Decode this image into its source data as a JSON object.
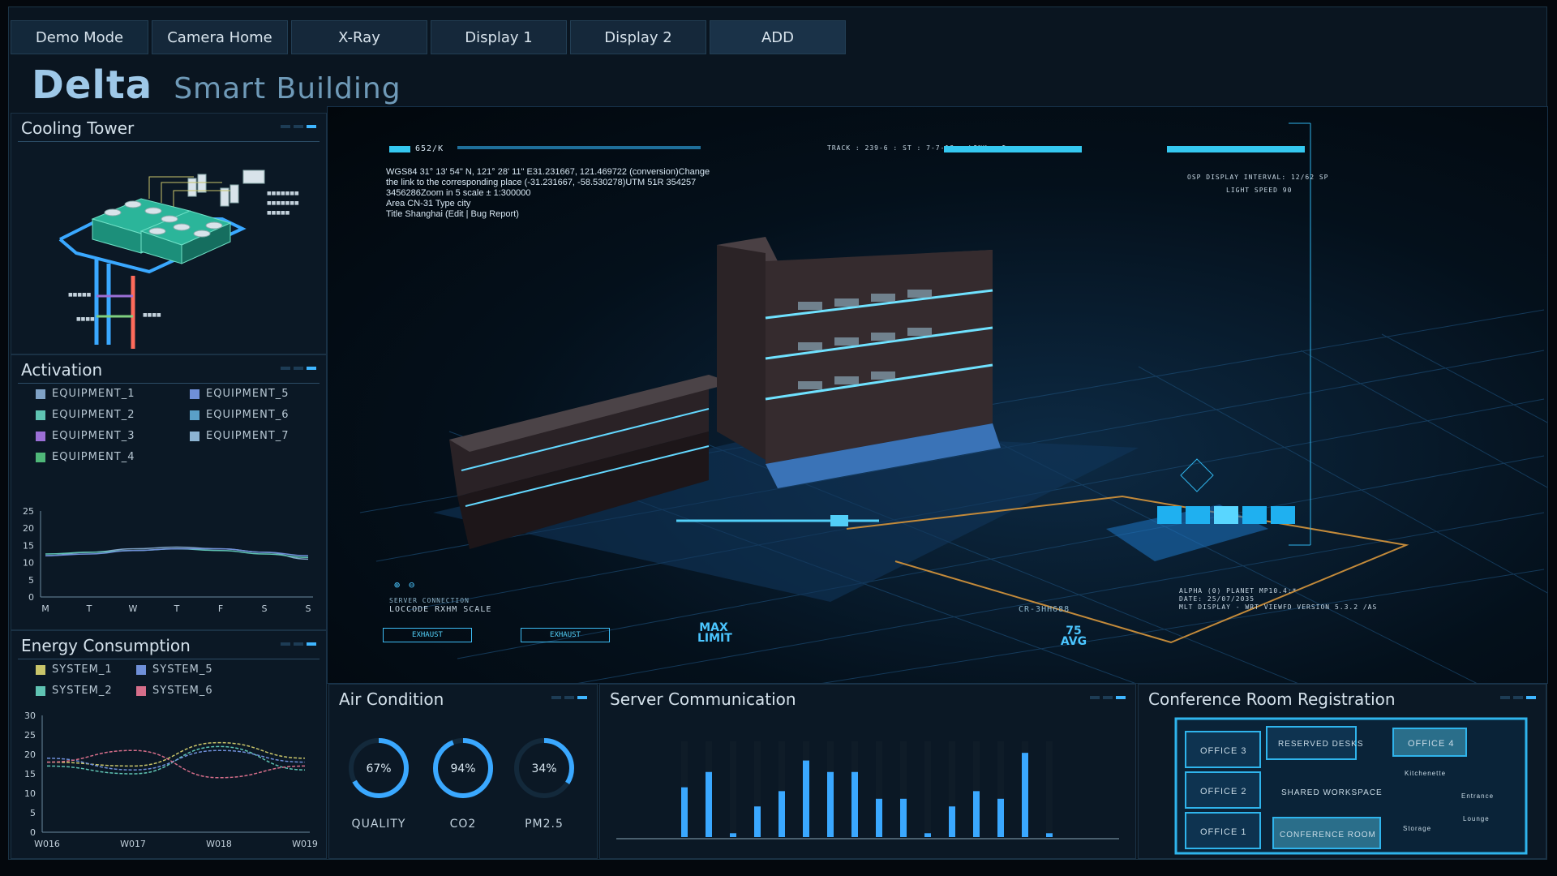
{
  "tabs": [
    {
      "label": "Demo Mode"
    },
    {
      "label": "Camera Home"
    },
    {
      "label": "X-Ray"
    },
    {
      "label": "Display 1"
    },
    {
      "label": "Display 2"
    },
    {
      "label": "ADD"
    }
  ],
  "header": {
    "brand": "Delta",
    "subtitle": "Smart Building"
  },
  "cooling_tower": {
    "title": "Cooling Tower"
  },
  "activation": {
    "title": "Activation",
    "legend": [
      {
        "label": "EQUIPMENT_1",
        "color": "#7fa2c6"
      },
      {
        "label": "EQUIPMENT_2",
        "color": "#5fc3b3"
      },
      {
        "label": "EQUIPMENT_3",
        "color": "#9b6fd6"
      },
      {
        "label": "EQUIPMENT_4",
        "color": "#4fb779"
      },
      {
        "label": "EQUIPMENT_5",
        "color": "#6f8fd8"
      },
      {
        "label": "EQUIPMENT_6",
        "color": "#5aa0c8"
      },
      {
        "label": "EQUIPMENT_7",
        "color": "#8db4d2"
      }
    ]
  },
  "energy": {
    "title": "Energy Consumption",
    "legend": [
      {
        "label": "SYSTEM_1",
        "color": "#c9c56a"
      },
      {
        "label": "SYSTEM_5",
        "color": "#6f8fd8"
      },
      {
        "label": "SYSTEM_2",
        "color": "#5fc3b3"
      },
      {
        "label": "SYSTEM_6",
        "color": "#d66e8a"
      }
    ]
  },
  "chart_data": [
    {
      "type": "line",
      "categories": [
        "M",
        "T",
        "W",
        "T",
        "F",
        "S",
        "S"
      ],
      "yticks": [
        0,
        5,
        10,
        15,
        20,
        25
      ],
      "ylim": [
        0,
        25
      ],
      "series": [
        {
          "name": "EQUIPMENT_1",
          "values": [
            12,
            13,
            14,
            14.5,
            14,
            13,
            11
          ]
        },
        {
          "name": "EQUIPMENT_2",
          "values": [
            12.5,
            13,
            13.5,
            14,
            13.5,
            12.5,
            11.5
          ]
        },
        {
          "name": "EQUIPMENT_5",
          "values": [
            12,
            12.5,
            13.5,
            14,
            14,
            13,
            12
          ]
        }
      ]
    },
    {
      "type": "line",
      "categories": [
        "W016",
        "W017",
        "W018",
        "W019"
      ],
      "yticks": [
        0,
        5,
        10,
        15,
        20,
        25,
        30
      ],
      "ylim": [
        0,
        30
      ],
      "series": [
        {
          "name": "SYSTEM_1",
          "values": [
            18,
            17,
            23,
            19
          ]
        },
        {
          "name": "SYSTEM_2",
          "values": [
            17,
            15,
            22,
            16
          ]
        },
        {
          "name": "SYSTEM_5",
          "values": [
            19,
            16,
            21,
            18
          ]
        },
        {
          "name": "SYSTEM_6",
          "values": [
            18,
            21,
            14,
            17
          ]
        }
      ]
    },
    {
      "type": "bar",
      "values": [
        13,
        17,
        1,
        8,
        12,
        20,
        17,
        17,
        10,
        10,
        1,
        8,
        12,
        10,
        22,
        1
      ]
    }
  ],
  "air_condition": {
    "title": "Air Condition",
    "gauges": [
      {
        "label": "QUALITY",
        "value": 67,
        "text": "67%"
      },
      {
        "label": "CO2",
        "value": 94,
        "text": "94%"
      },
      {
        "label": "PM2.5",
        "value": 34,
        "text": "34%"
      }
    ]
  },
  "server": {
    "title": "Server Communication"
  },
  "conference": {
    "title": "Conference Room Registration",
    "rooms": {
      "office3": "OFFICE 3",
      "office2": "OFFICE 2",
      "office1": "OFFICE 1",
      "office4": "OFFICE 4",
      "reserved": "RESERVED DESKS",
      "shared": "SHARED WORKSPACE",
      "conference": "CONFERENCE ROOM",
      "kitchenette": "Kitchenette",
      "entrance": "Entrance",
      "lounge": "Lounge",
      "storage": "Storage"
    }
  },
  "view": {
    "info_lines": [
      "WGS84 31° 13' 54\" N, 121° 28' 11\" E31.231667, 121.469722 (conversion)Change",
      "the link to the corresponding place (-31.231667, -58.530278)UTM 51R 354257",
      "3456286Zoom in 5 scale ± 1:300000",
      "Area CN-31 Type city",
      "Title Shanghai (Edit | Bug Report)"
    ],
    "code_top": "652/K",
    "track": "TRACK : 239-6 : ST : 7-7-18 : LINK : I",
    "osp": "OSP DISPLAY INTERVAL: 12/62 SP",
    "light": "LIGHT SPEED 90",
    "server_conn": "SERVER CONNECTION",
    "loccode": "LOCCODE RXHM SCALE",
    "exhaust": "EXHAUST",
    "max_limit": "MAX LIMIT",
    "avg": "75 AVG",
    "cr": "CR-3HH688",
    "date": "DATE: 25/07/2035",
    "version": "MLT DISPLAY - WRT VIEWFD VERSION 5.3.2 /AS",
    "alpha": "ALPHA (0) PLANET MP10.4:*"
  }
}
